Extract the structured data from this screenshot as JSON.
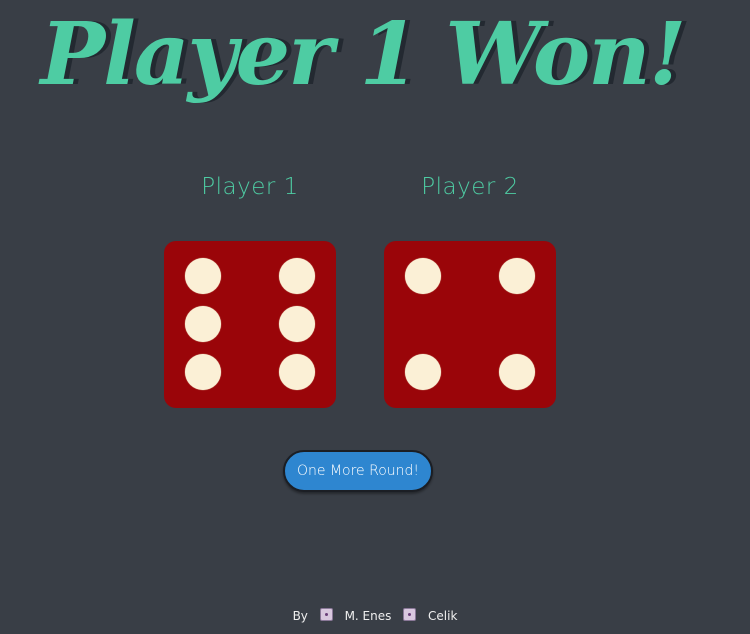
{
  "title": "Player 1 Won!",
  "players": [
    {
      "label": "Player 1",
      "die_value": 6
    },
    {
      "label": "Player 2",
      "die_value": 4
    }
  ],
  "button_label": "One More Round!",
  "footer": {
    "by": "By",
    "first_name": "M. Enes",
    "last_name": "Celik",
    "icon": "die-icon"
  },
  "colors": {
    "background": "#393e46",
    "accent": "#4ecca3",
    "die": "#9a0509",
    "pip": "#fbf0d6",
    "button": "#2e86d0"
  }
}
